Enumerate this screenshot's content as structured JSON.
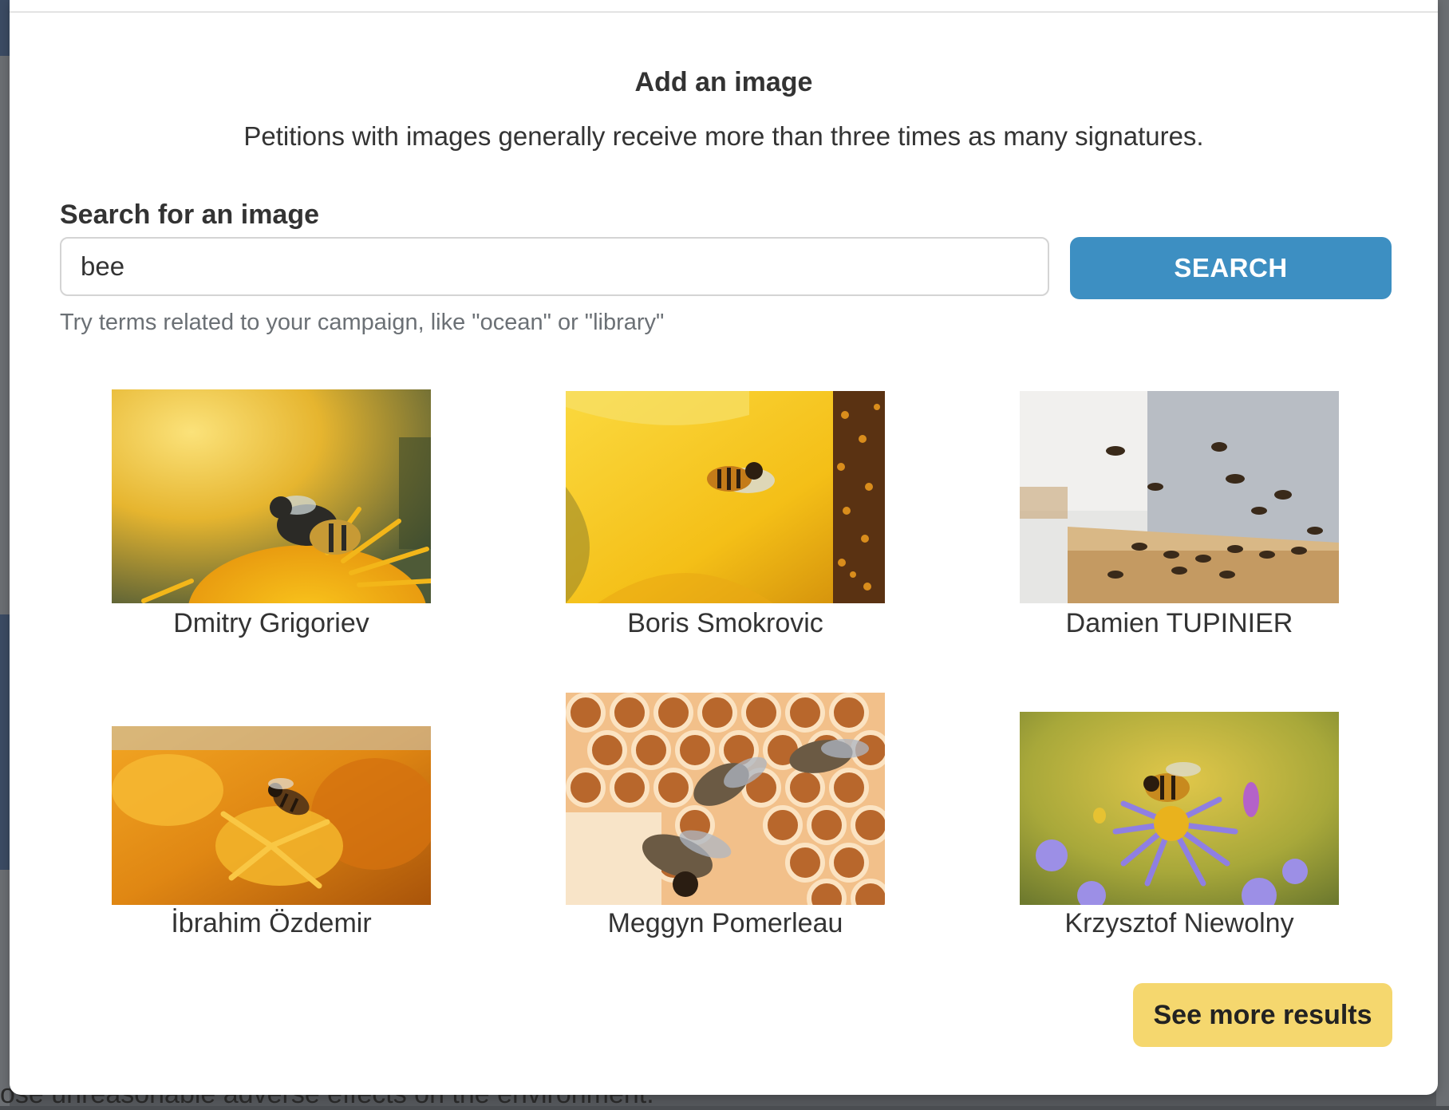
{
  "background": {
    "footer_text": "ose unreasonable adverse effects on the environment."
  },
  "modal": {
    "title": "Add an image",
    "subtitle": "Petitions with images generally receive more than three times as many signatures."
  },
  "search": {
    "label": "Search for an image",
    "value": "bee",
    "button_label": "SEARCH",
    "hint": "Try terms related to your campaign, like \"ocean\" or \"library\""
  },
  "results": [
    {
      "credit": "Dmitry Grigoriev"
    },
    {
      "credit": "Boris Smokrovic"
    },
    {
      "credit": "Damien TUPINIER"
    },
    {
      "credit": "İbrahim Özdemir"
    },
    {
      "credit": "Meggyn Pomerleau"
    },
    {
      "credit": "Krzysztof Niewolny"
    }
  ],
  "see_more_label": "See more results",
  "colors": {
    "search_button": "#3d8fc2",
    "see_more_button": "#f5d76e"
  }
}
